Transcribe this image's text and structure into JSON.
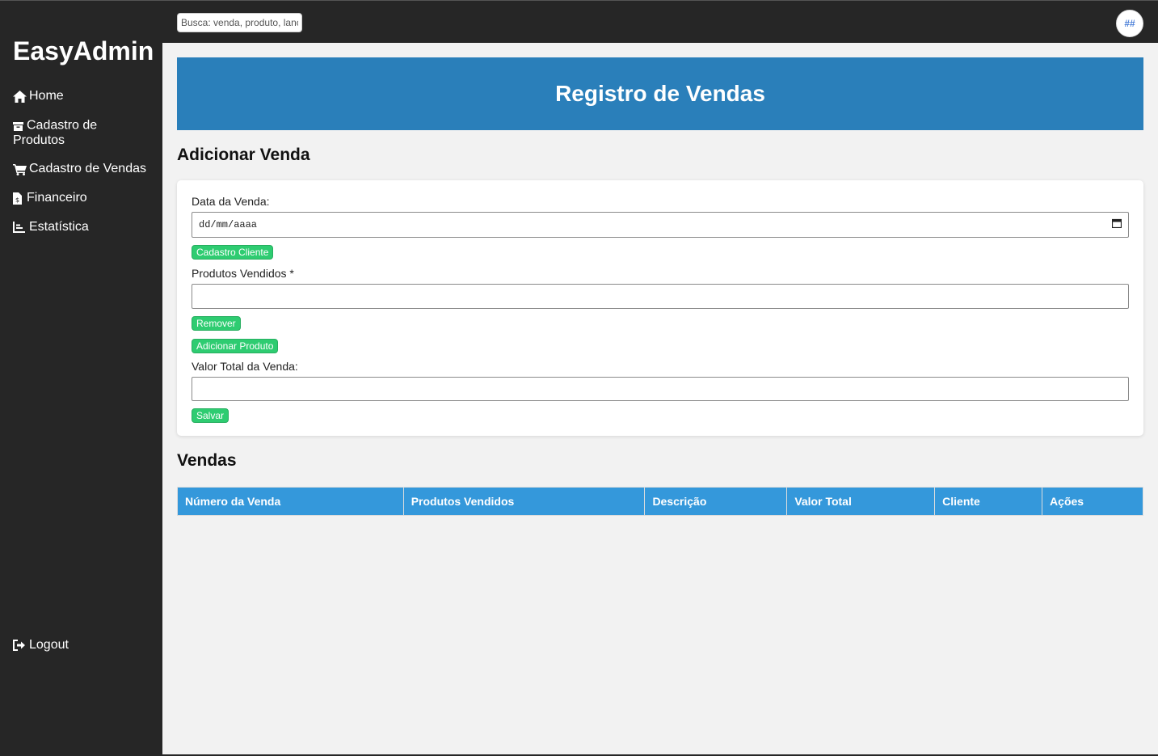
{
  "topbar": {
    "search_placeholder": "Busca: venda, produto, lançamento...",
    "avatar_text": "##"
  },
  "sidebar": {
    "brand": "EasyAdmin",
    "items": [
      {
        "label": "Home",
        "icon": "home-icon"
      },
      {
        "label": "Cadastro de Produtos",
        "icon": "box-icon"
      },
      {
        "label": "Cadastro de Vendas",
        "icon": "cart-icon"
      },
      {
        "label": "Financeiro",
        "icon": "invoice-icon"
      },
      {
        "label": "Estatística",
        "icon": "chart-icon"
      }
    ],
    "logout": {
      "label": "Logout",
      "icon": "logout-icon"
    }
  },
  "main": {
    "banner_title": "Registro de Vendas",
    "form_title": "Adicionar Venda",
    "form": {
      "date_label": "Data da Venda:",
      "date_placeholder": "dd/mm/aaaa",
      "client_button": "Cadastro Cliente",
      "products_label": "Produtos Vendidos *",
      "products_value": "",
      "remove_button": "Remover",
      "add_product_button": "Adicionar Produto",
      "total_label": "Valor Total da Venda:",
      "total_value": "",
      "save_button": "Salvar"
    },
    "table_title": "Vendas",
    "table": {
      "columns": [
        "Número da Venda",
        "Produtos Vendidos",
        "Descrição",
        "Valor Total",
        "Cliente",
        "Ações"
      ],
      "rows": []
    }
  },
  "colors": {
    "sidebar": "#262626",
    "banner": "#2a7fba",
    "table_header": "#3498db",
    "button": "#2ecc71"
  }
}
